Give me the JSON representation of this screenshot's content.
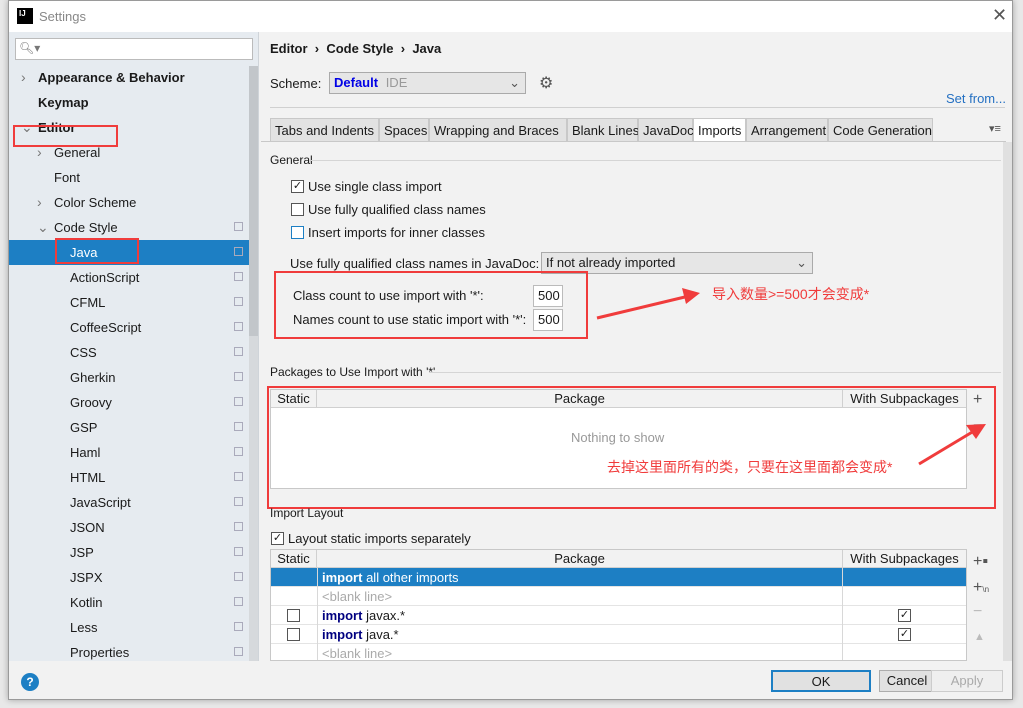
{
  "window": {
    "title": "Settings",
    "app_icon": "IJ"
  },
  "search": {
    "placeholder": ""
  },
  "sidebar": {
    "items": [
      {
        "label": "Appearance & Behavior",
        "bold": true,
        "chev": "right"
      },
      {
        "label": "Keymap",
        "bold": true
      },
      {
        "label": "Editor",
        "bold": true,
        "chev": "down"
      },
      {
        "label": "General",
        "chev": "right"
      },
      {
        "label": "Font"
      },
      {
        "label": "Color Scheme",
        "chev": "right"
      },
      {
        "label": "Code Style",
        "chev": "down"
      },
      {
        "label": "Java",
        "selected": true
      },
      {
        "label": "ActionScript"
      },
      {
        "label": "CFML"
      },
      {
        "label": "CoffeeScript"
      },
      {
        "label": "CSS"
      },
      {
        "label": "Gherkin"
      },
      {
        "label": "Groovy"
      },
      {
        "label": "GSP"
      },
      {
        "label": "Haml"
      },
      {
        "label": "HTML"
      },
      {
        "label": "JavaScript"
      },
      {
        "label": "JSON"
      },
      {
        "label": "JSP"
      },
      {
        "label": "JSPX"
      },
      {
        "label": "Kotlin"
      },
      {
        "label": "Less"
      },
      {
        "label": "Properties"
      }
    ]
  },
  "breadcrumb": [
    "Editor",
    "Code Style",
    "Java"
  ],
  "scheme": {
    "label": "Scheme:",
    "name": "Default",
    "type": "IDE",
    "set_from": "Set from..."
  },
  "tabs": [
    "Tabs and Indents",
    "Spaces",
    "Wrapping and Braces",
    "Blank Lines",
    "JavaDoc",
    "Imports",
    "Arrangement",
    "Code Generation"
  ],
  "active_tab": "Imports",
  "general": {
    "title": "General",
    "use_single": {
      "label": "Use single class import",
      "checked": true
    },
    "use_fq": {
      "label": "Use fully qualified class names",
      "checked": false
    },
    "inner": {
      "label": "Insert imports for inner classes",
      "checked": false
    },
    "javadoc_label": "Use fully qualified class names in JavaDoc:",
    "javadoc_value": "If not already imported",
    "class_count_label": "Class count to use import with '*':",
    "class_count": "500",
    "names_count_label": "Names count to use static import with '*':",
    "names_count": "500"
  },
  "annotation1": "导入数量>=500才会变成*",
  "annotation2": "去掉这里面所有的类，只要在这里面都会变成*",
  "packages": {
    "title": "Packages to Use Import with '*'",
    "cols": [
      "Static",
      "Package",
      "With Subpackages"
    ],
    "empty": "Nothing to show"
  },
  "layout": {
    "title": "Import Layout",
    "separate": {
      "label": "Layout static imports separately",
      "checked": true
    },
    "cols": [
      "Static",
      "Package",
      "With Subpackages"
    ],
    "rows": [
      {
        "kw": "import",
        "text": "all other imports",
        "selected": true
      },
      {
        "text": "<blank line>",
        "blank": true
      },
      {
        "kw": "import",
        "text": "javax.*",
        "static": false,
        "sub": true
      },
      {
        "kw": "import",
        "text": "java.*",
        "static": false,
        "sub": true
      },
      {
        "text": "<blank line>",
        "blank": true
      }
    ]
  },
  "buttons": {
    "ok": "OK",
    "cancel": "Cancel",
    "apply": "Apply",
    "help": "?"
  },
  "colors": {
    "accent": "#1d7fc4",
    "annotation": "#f03c3c"
  }
}
